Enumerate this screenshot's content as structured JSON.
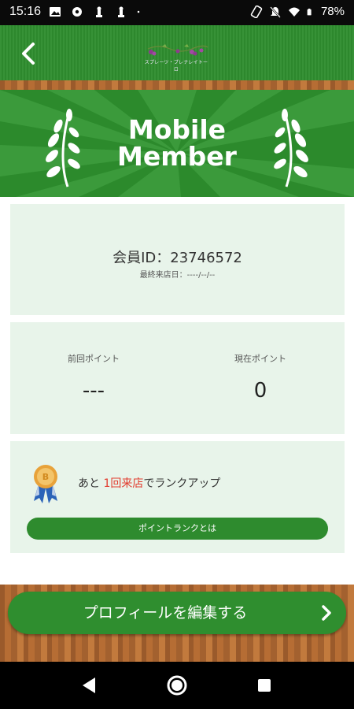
{
  "status_bar": {
    "time": "15:16",
    "battery": "78%",
    "icons": [
      "image-icon",
      "settings-icon",
      "chess-icon",
      "chess-icon",
      "dot-icon",
      "rotate-icon",
      "mute-icon",
      "wifi-icon",
      "battery-icon"
    ]
  },
  "header": {
    "back_icon": "chevron-left-icon",
    "logo_text": "スプレーツ・プレナレイトーロ"
  },
  "banner": {
    "title_line1": "Mobile",
    "title_line2": "Member"
  },
  "member": {
    "id_label": "会員ID：23746572",
    "last_visit": "最終来店日：----/--/--"
  },
  "points": {
    "previous_label": "前回ポイント",
    "previous_value": "---",
    "current_label": "現在ポイント",
    "current_value": "0"
  },
  "rank": {
    "prefix": "あと",
    "highlight": "1回来店",
    "suffix": "でランクアップ",
    "button_label": "ポイントランクとは"
  },
  "profile_button": {
    "label": "プロフィールを編集する"
  },
  "colors": {
    "primary_green": "#2f8e2f",
    "card_bg": "#e8f4ea",
    "highlight_red": "#e23b2e",
    "wood": "#b66d34"
  }
}
